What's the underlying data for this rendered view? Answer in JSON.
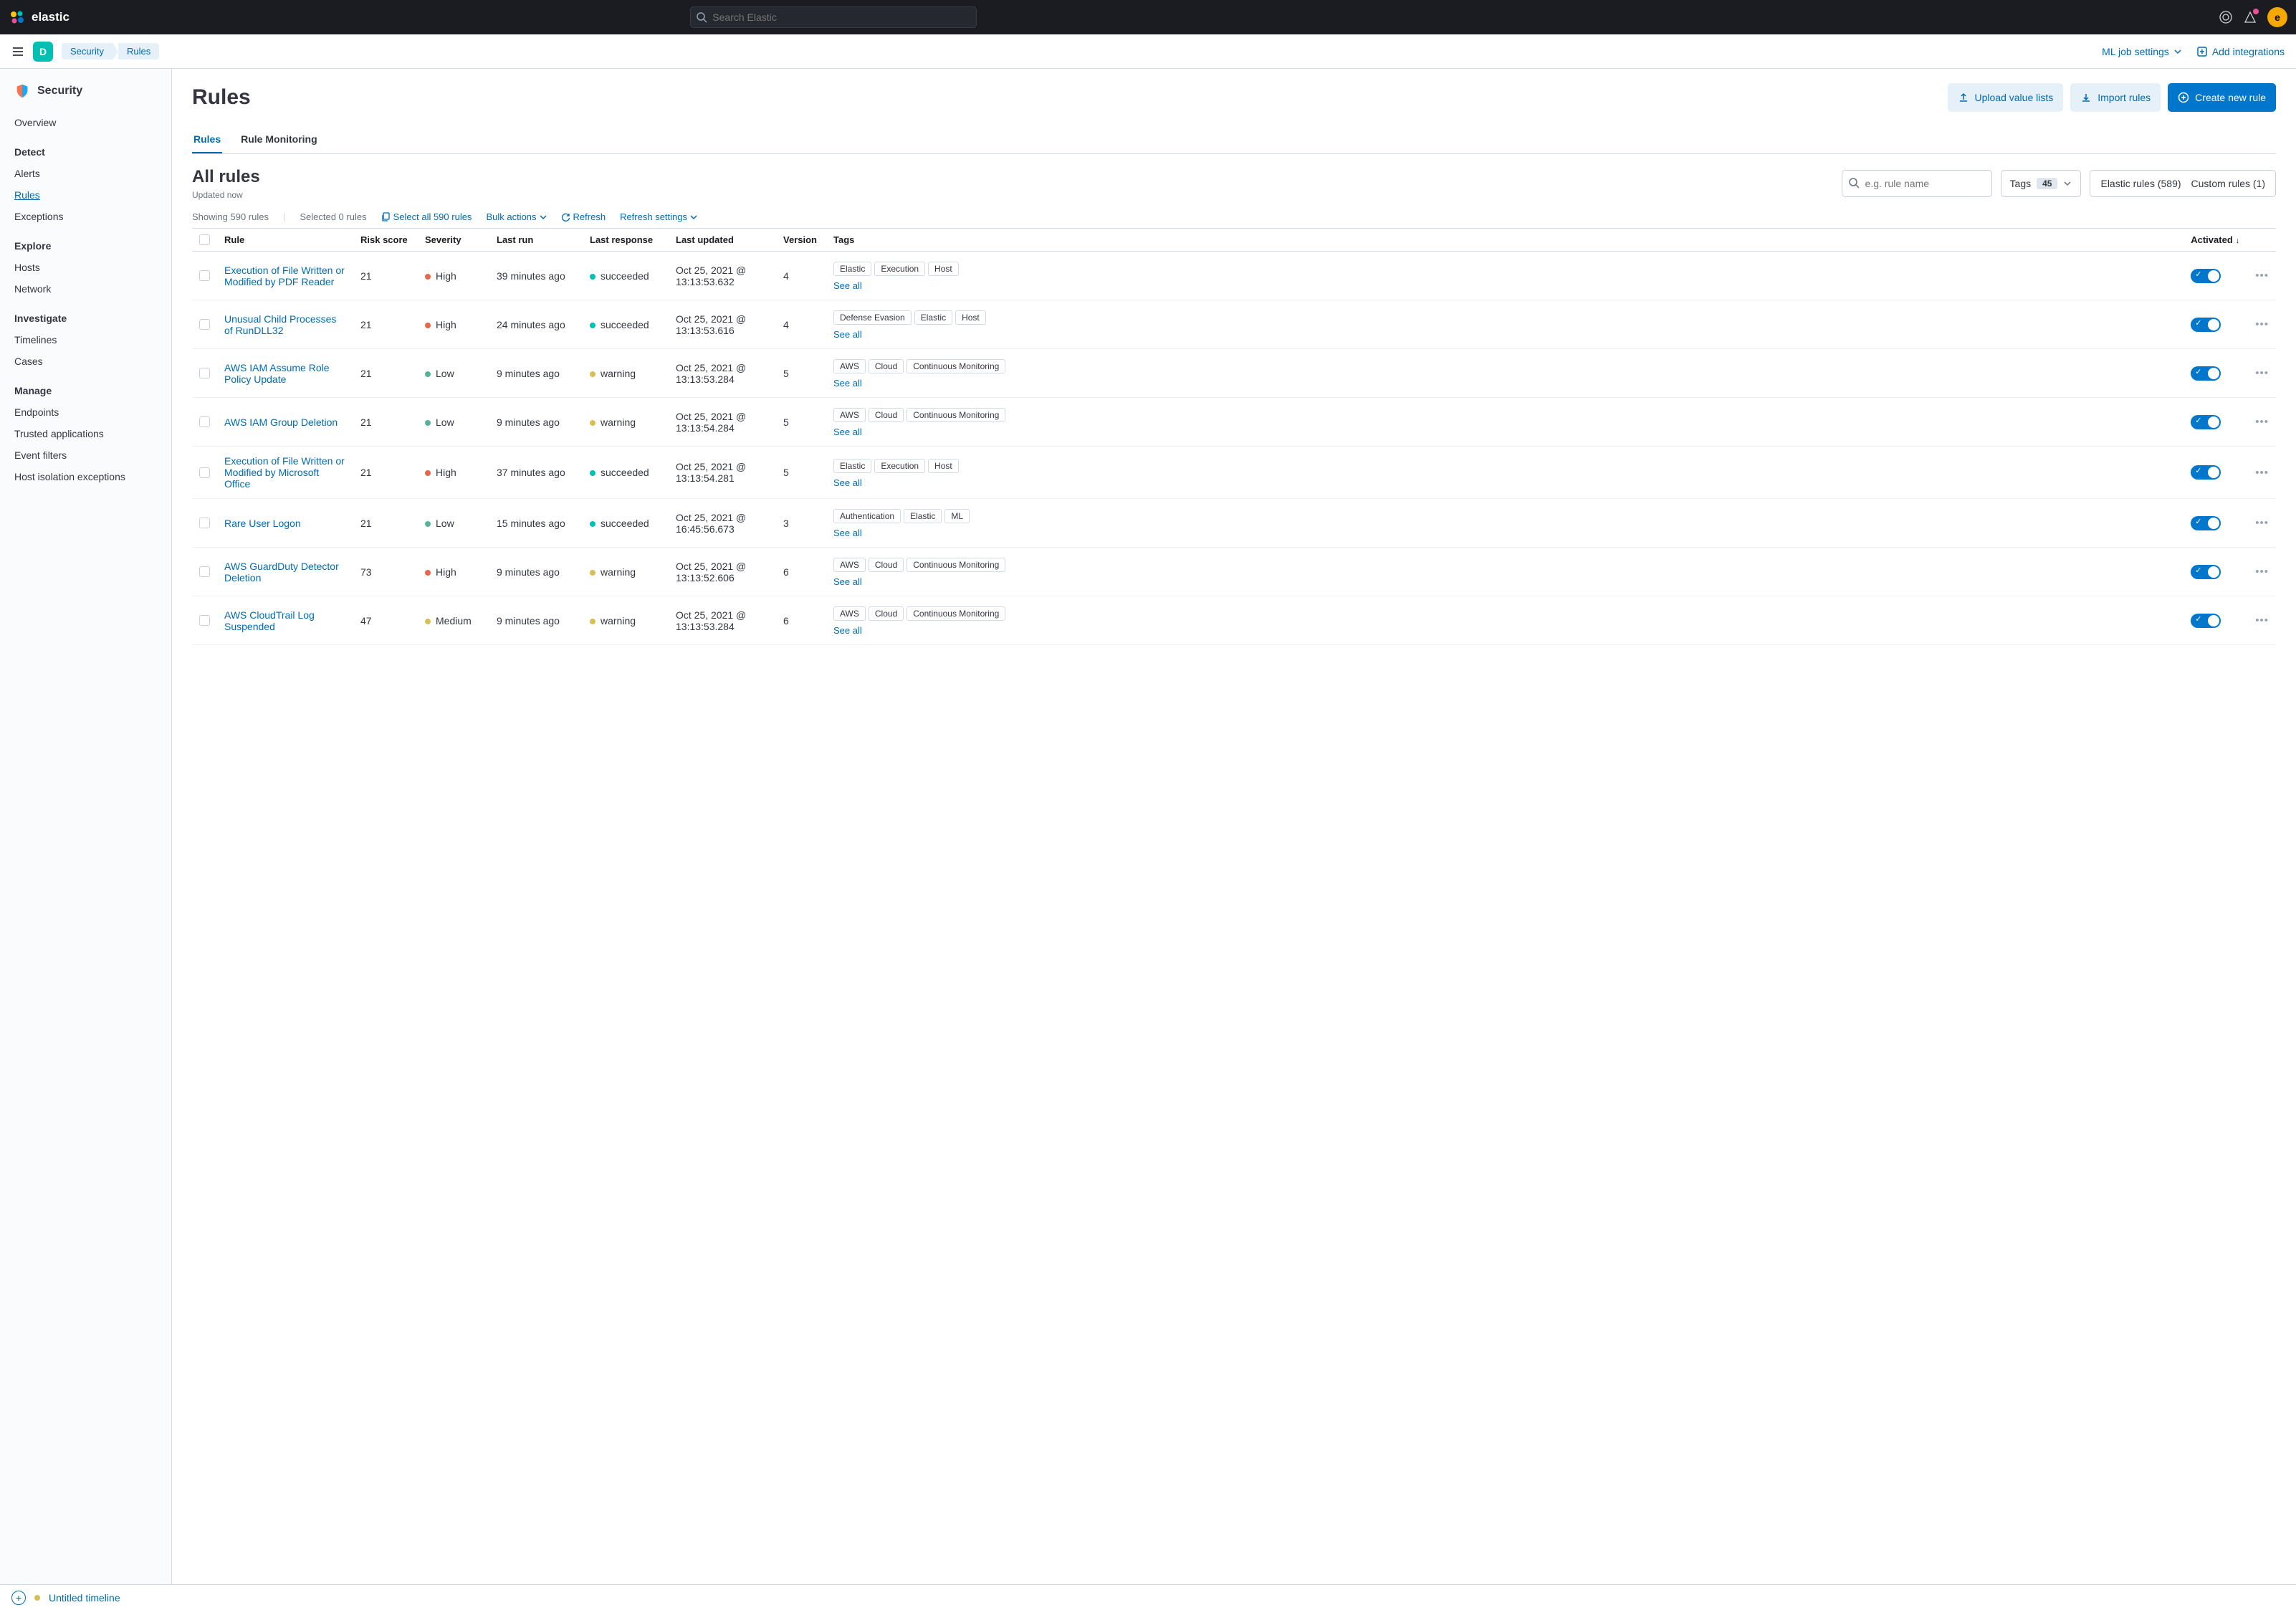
{
  "top": {
    "brand": "elastic",
    "search_placeholder": "Search Elastic",
    "avatar_initial": "e"
  },
  "subnav": {
    "space_initial": "D",
    "crumbs": [
      "Security",
      "Rules"
    ],
    "ml_settings": "ML job settings",
    "add_integrations": "Add integrations"
  },
  "sidebar": {
    "app_title": "Security",
    "groups": [
      {
        "heading": null,
        "items": [
          {
            "label": "Overview",
            "active": false
          }
        ]
      },
      {
        "heading": "Detect",
        "items": [
          {
            "label": "Alerts",
            "active": false
          },
          {
            "label": "Rules",
            "active": true
          },
          {
            "label": "Exceptions",
            "active": false
          }
        ]
      },
      {
        "heading": "Explore",
        "items": [
          {
            "label": "Hosts",
            "active": false
          },
          {
            "label": "Network",
            "active": false
          }
        ]
      },
      {
        "heading": "Investigate",
        "items": [
          {
            "label": "Timelines",
            "active": false
          },
          {
            "label": "Cases",
            "active": false
          }
        ]
      },
      {
        "heading": "Manage",
        "items": [
          {
            "label": "Endpoints",
            "active": false
          },
          {
            "label": "Trusted applications",
            "active": false
          },
          {
            "label": "Event filters",
            "active": false
          },
          {
            "label": "Host isolation exceptions",
            "active": false
          }
        ]
      }
    ]
  },
  "page": {
    "title": "Rules",
    "actions": {
      "upload": "Upload value lists",
      "import": "Import rules",
      "create": "Create new rule"
    },
    "tabs": [
      "Rules",
      "Rule Monitoring"
    ],
    "active_tab": 0,
    "all_rules": "All rules",
    "updated": "Updated now",
    "search_placeholder": "e.g. rule name",
    "tags_label": "Tags",
    "tags_count": "45",
    "elastic_rules": "Elastic rules (589)",
    "custom_rules": "Custom rules (1)",
    "showing": "Showing 590 rules",
    "selected": "Selected 0 rules",
    "select_all": "Select all 590 rules",
    "bulk_actions": "Bulk actions",
    "refresh": "Refresh",
    "refresh_settings": "Refresh settings",
    "columns": {
      "rule": "Rule",
      "risk": "Risk score",
      "severity": "Severity",
      "last_run": "Last run",
      "last_response": "Last response",
      "last_updated": "Last updated",
      "version": "Version",
      "tags": "Tags",
      "activated": "Activated"
    },
    "see_all": "See all",
    "rows": [
      {
        "name": "Execution of File Written or Modified by PDF Reader",
        "risk": "21",
        "sev": "High",
        "sev_cls": "sev-high",
        "run": "39 minutes ago",
        "resp": "succeeded",
        "resp_cls": "resp-succeeded",
        "updated": "Oct 25, 2021 @ 13:13:53.632",
        "ver": "4",
        "tags": [
          "Elastic",
          "Execution",
          "Host"
        ]
      },
      {
        "name": "Unusual Child Processes of RunDLL32",
        "risk": "21",
        "sev": "High",
        "sev_cls": "sev-high",
        "run": "24 minutes ago",
        "resp": "succeeded",
        "resp_cls": "resp-succeeded",
        "updated": "Oct 25, 2021 @ 13:13:53.616",
        "ver": "4",
        "tags": [
          "Defense Evasion",
          "Elastic",
          "Host"
        ]
      },
      {
        "name": "AWS IAM Assume Role Policy Update",
        "risk": "21",
        "sev": "Low",
        "sev_cls": "sev-low",
        "run": "9 minutes ago",
        "resp": "warning",
        "resp_cls": "resp-warning",
        "updated": "Oct 25, 2021 @ 13:13:53.284",
        "ver": "5",
        "tags": [
          "AWS",
          "Cloud",
          "Continuous Monitoring"
        ]
      },
      {
        "name": "AWS IAM Group Deletion",
        "risk": "21",
        "sev": "Low",
        "sev_cls": "sev-low",
        "run": "9 minutes ago",
        "resp": "warning",
        "resp_cls": "resp-warning",
        "updated": "Oct 25, 2021 @ 13:13:54.284",
        "ver": "5",
        "tags": [
          "AWS",
          "Cloud",
          "Continuous Monitoring"
        ]
      },
      {
        "name": "Execution of File Written or Modified by Microsoft Office",
        "risk": "21",
        "sev": "High",
        "sev_cls": "sev-high",
        "run": "37 minutes ago",
        "resp": "succeeded",
        "resp_cls": "resp-succeeded",
        "updated": "Oct 25, 2021 @ 13:13:54.281",
        "ver": "5",
        "tags": [
          "Elastic",
          "Execution",
          "Host"
        ]
      },
      {
        "name": "Rare User Logon",
        "risk": "21",
        "sev": "Low",
        "sev_cls": "sev-low",
        "run": "15 minutes ago",
        "resp": "succeeded",
        "resp_cls": "resp-succeeded",
        "updated": "Oct 25, 2021 @ 16:45:56.673",
        "ver": "3",
        "tags": [
          "Authentication",
          "Elastic",
          "ML"
        ]
      },
      {
        "name": "AWS GuardDuty Detector Deletion",
        "risk": "73",
        "sev": "High",
        "sev_cls": "sev-high",
        "run": "9 minutes ago",
        "resp": "warning",
        "resp_cls": "resp-warning",
        "updated": "Oct 25, 2021 @ 13:13:52.606",
        "ver": "6",
        "tags": [
          "AWS",
          "Cloud",
          "Continuous Monitoring"
        ]
      },
      {
        "name": "AWS CloudTrail Log Suspended",
        "risk": "47",
        "sev": "Medium",
        "sev_cls": "sev-medium",
        "run": "9 minutes ago",
        "resp": "warning",
        "resp_cls": "resp-warning",
        "updated": "Oct 25, 2021 @ 13:13:53.284",
        "ver": "6",
        "tags": [
          "AWS",
          "Cloud",
          "Continuous Monitoring"
        ]
      }
    ]
  },
  "footer": {
    "timeline": "Untitled timeline"
  }
}
